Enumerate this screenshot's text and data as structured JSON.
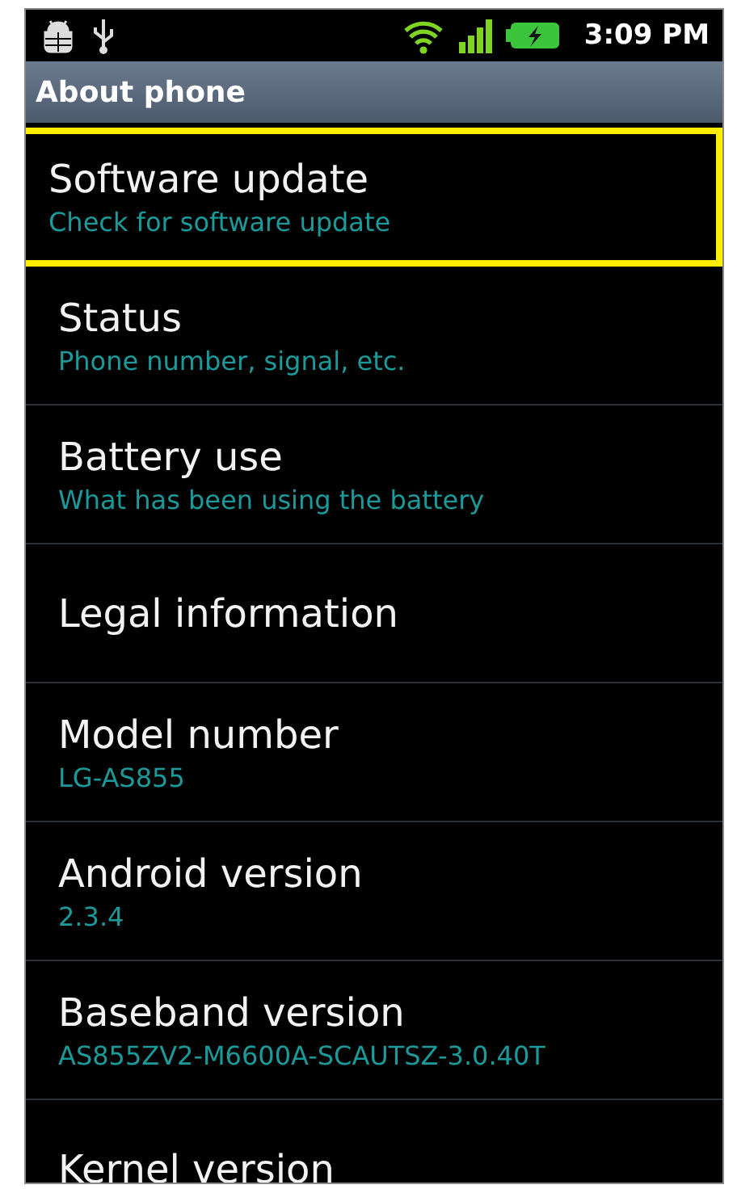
{
  "status_bar": {
    "time": "3:09 PM"
  },
  "title_bar": {
    "title": "About phone"
  },
  "items": [
    {
      "title": "Software update",
      "summary": "Check for software update",
      "highlighted": true
    },
    {
      "title": "Status",
      "summary": "Phone number, signal, etc.",
      "highlighted": false
    },
    {
      "title": "Battery use",
      "summary": "What has been using the battery",
      "highlighted": false
    },
    {
      "title": "Legal information",
      "highlighted": false
    },
    {
      "title": "Model number",
      "summary": "LG-AS855",
      "highlighted": false
    },
    {
      "title": "Android version",
      "summary": "2.3.4",
      "highlighted": false
    },
    {
      "title": "Baseband version",
      "summary": "AS855ZV2-M6600A-SCAUTSZ-3.0.40T",
      "highlighted": false
    },
    {
      "title": "Kernel version",
      "highlighted": false
    }
  ]
}
